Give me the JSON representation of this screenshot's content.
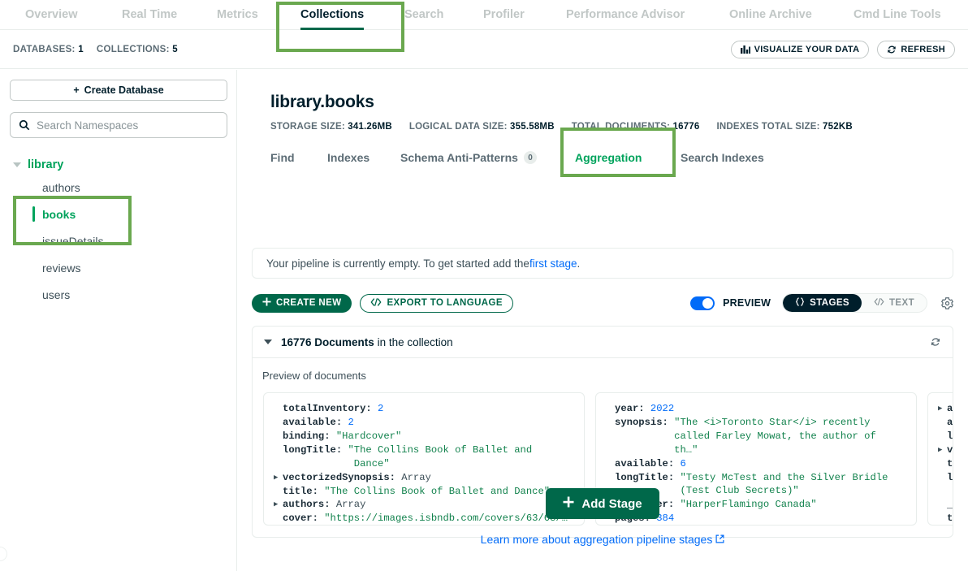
{
  "topnav": {
    "tabs": [
      {
        "label": "Overview",
        "active": false
      },
      {
        "label": "Real Time",
        "active": false
      },
      {
        "label": "Metrics",
        "active": false
      },
      {
        "label": "Collections",
        "active": true
      },
      {
        "label": "Search",
        "active": false
      },
      {
        "label": "Profiler",
        "active": false
      },
      {
        "label": "Performance Advisor",
        "active": false
      },
      {
        "label": "Online Archive",
        "active": false
      },
      {
        "label": "Cmd Line Tools",
        "active": false
      }
    ]
  },
  "dbstats": {
    "databases_label": "DATABASES:",
    "databases_value": "1",
    "collections_label": "COLLECTIONS:",
    "collections_value": "5",
    "visualize_button": "VISUALIZE YOUR DATA",
    "refresh_button": "REFRESH"
  },
  "sidebar": {
    "create_database_button": "Create Database",
    "search_placeholder": "Search Namespaces",
    "search_value": "",
    "database": "library",
    "collections": [
      {
        "label": "authors",
        "active": false
      },
      {
        "label": "books",
        "active": true
      },
      {
        "label": "issueDetails",
        "active": false
      },
      {
        "label": "reviews",
        "active": false
      },
      {
        "label": "users",
        "active": false
      }
    ]
  },
  "collection": {
    "title": "library.books",
    "stats": [
      {
        "label": "STORAGE SIZE:",
        "value": "341.26MB"
      },
      {
        "label": "LOGICAL DATA SIZE:",
        "value": "355.58MB"
      },
      {
        "label": "TOTAL DOCUMENTS:",
        "value": "16776"
      },
      {
        "label": "INDEXES TOTAL SIZE:",
        "value": "752KB"
      }
    ],
    "tabs": [
      {
        "label": "Find",
        "active": false,
        "badge": null
      },
      {
        "label": "Indexes",
        "active": false,
        "badge": null
      },
      {
        "label": "Schema Anti-Patterns",
        "active": false,
        "badge": "0"
      },
      {
        "label": "Aggregation",
        "active": true,
        "badge": null
      },
      {
        "label": "Search Indexes",
        "active": false,
        "badge": null
      }
    ]
  },
  "pipeline": {
    "banner_text": "Your pipeline is currently empty. To get started add the ",
    "banner_link": "first stage",
    "banner_suffix": ".",
    "create_new_button": "CREATE NEW",
    "export_button": "EXPORT TO LANGUAGE",
    "preview_toggle_label": "PREVIEW",
    "stages_button": "STAGES",
    "text_button": "TEXT",
    "add_stage_button": "Add Stage",
    "learn_more_link": "Learn more about aggregation pipeline stages"
  },
  "preview": {
    "count": "16776 Documents",
    "count_suffix": " in the collection",
    "subtitle": "Preview of documents",
    "documents": [
      {
        "lines": [
          {
            "arrow": false,
            "key": "totalInventory",
            "sep": ": ",
            "value": "2",
            "type": "n"
          },
          {
            "arrow": false,
            "key": "available",
            "sep": ": ",
            "value": "2",
            "type": "n"
          },
          {
            "arrow": false,
            "key": "binding",
            "sep": ": ",
            "value": "\"Hardcover\"",
            "type": "s"
          },
          {
            "arrow": false,
            "key": "longTitle",
            "sep": ": ",
            "value": "\"The Collins Book of Ballet and",
            "type": "s"
          },
          {
            "arrow": false,
            "key": "",
            "sep": "",
            "value": "            Dance\"",
            "type": "s"
          },
          {
            "arrow": true,
            "key": "vectorizedSynopsis",
            "sep": ": ",
            "value": "Array",
            "type": "t"
          },
          {
            "arrow": false,
            "key": "title",
            "sep": ": ",
            "value": "\"The Collins Book of Ballet and Dance\"",
            "type": "s"
          },
          {
            "arrow": true,
            "key": "authors",
            "sep": ": ",
            "value": "Array",
            "type": "t"
          },
          {
            "arrow": false,
            "key": "cover",
            "sep": ": ",
            "value": "\"https://images.isbndb.com/covers/63/63/…",
            "type": "s"
          }
        ]
      },
      {
        "lines": [
          {
            "arrow": false,
            "key": "year",
            "sep": ": ",
            "value": "2022",
            "type": "n"
          },
          {
            "arrow": false,
            "key": "synopsis",
            "sep": ": ",
            "value": "\"The <i>Toronto Star</i> recently",
            "type": "s"
          },
          {
            "arrow": false,
            "key": "",
            "sep": "",
            "value": "          called Farley Mowat, the author of",
            "type": "s"
          },
          {
            "arrow": false,
            "key": "",
            "sep": "",
            "value": "          th…\"",
            "type": "s"
          },
          {
            "arrow": false,
            "key": "available",
            "sep": ": ",
            "value": "6",
            "type": "n"
          },
          {
            "arrow": false,
            "key": "longTitle",
            "sep": ": ",
            "value": "\"Testy McTest and the Silver Bridle",
            "type": "s"
          },
          {
            "arrow": false,
            "key": "",
            "sep": "",
            "value": "           (Test Club Secrets)\"",
            "type": "s"
          },
          {
            "arrow": false,
            "key": "publisher",
            "sep": ": ",
            "value": "\"HarperFlamingo Canada\"",
            "type": "s"
          },
          {
            "arrow": false,
            "key": "pages",
            "sep": ": ",
            "value": "384",
            "type": "n"
          }
        ]
      },
      {
        "lines": [
          {
            "arrow": true,
            "key": "att",
            "sep": "",
            "value": "",
            "type": "t"
          },
          {
            "arrow": false,
            "key": "ava",
            "sep": "",
            "value": "",
            "type": "t"
          },
          {
            "arrow": false,
            "key": "lan",
            "sep": "",
            "value": "",
            "type": "t"
          },
          {
            "arrow": true,
            "key": "vec",
            "sep": "",
            "value": "",
            "type": "t"
          },
          {
            "arrow": false,
            "key": "tot",
            "sep": "",
            "value": "",
            "type": "t"
          },
          {
            "arrow": false,
            "key": "lon",
            "sep": "",
            "value": "",
            "type": "t"
          },
          {
            "arrow": false,
            "key": "",
            "sep": "",
            "value": "",
            "type": "t"
          },
          {
            "arrow": false,
            "key": "_id",
            "sep": "",
            "value": "",
            "type": "t"
          },
          {
            "arrow": false,
            "key": "tit",
            "sep": "",
            "value": "",
            "type": "t"
          }
        ]
      }
    ]
  },
  "colors": {
    "brand_green": "#00684A",
    "accent_green": "#00A35C",
    "link_blue": "#016BF8",
    "annotation_green": "#6AA84F",
    "text_dark": "#001E2B",
    "text_muted": "#5C6C75"
  }
}
